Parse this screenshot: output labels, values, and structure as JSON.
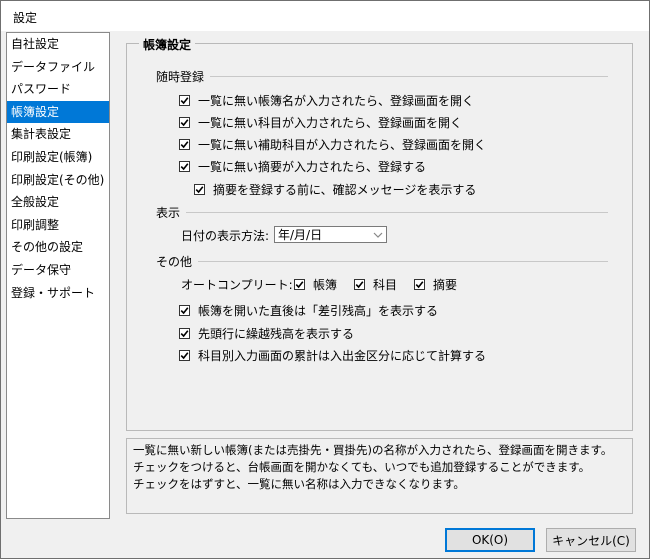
{
  "window": {
    "title": "設定"
  },
  "sidebar": {
    "items": [
      {
        "label": "自社設定"
      },
      {
        "label": "データファイル"
      },
      {
        "label": "パスワード"
      },
      {
        "label": "帳簿設定"
      },
      {
        "label": "集計表設定"
      },
      {
        "label": "印刷設定(帳簿)"
      },
      {
        "label": "印刷設定(その他)"
      },
      {
        "label": "全般設定"
      },
      {
        "label": "印刷調整"
      },
      {
        "label": "その他の設定"
      },
      {
        "label": "データ保守"
      },
      {
        "label": "登録・サポート"
      }
    ],
    "selected": "帳簿設定"
  },
  "main": {
    "group_title": "帳簿設定",
    "sections": {
      "zuiji": {
        "title": "随時登録",
        "options": [
          {
            "label": "一覧に無い帳簿名が入力されたら、登録画面を開く",
            "checked": true
          },
          {
            "label": "一覧に無い科目が入力されたら、登録画面を開く",
            "checked": true
          },
          {
            "label": "一覧に無い補助科目が入力されたら、登録画面を開く",
            "checked": true
          },
          {
            "label": "一覧に無い摘要が入力されたら、登録する",
            "checked": true
          },
          {
            "label": "摘要を登録する前に、確認メッセージを表示する",
            "checked": true
          }
        ]
      },
      "hyouji": {
        "title": "表示",
        "date_label": "日付の表示方法:",
        "date_value": "年/月/日"
      },
      "sonota": {
        "title": "その他",
        "autocomplete_label": "オートコンプリート:",
        "autocomplete": [
          {
            "label": "帳簿",
            "checked": true
          },
          {
            "label": "科目",
            "checked": true
          },
          {
            "label": "摘要",
            "checked": true
          }
        ],
        "options": [
          {
            "label": "帳簿を開いた直後は「差引残高」を表示する",
            "checked": true
          },
          {
            "label": "先頭行に繰越残高を表示する",
            "checked": true
          },
          {
            "label": "科目別入力画面の累計は入出金区分に応じて計算する",
            "checked": true
          }
        ]
      }
    }
  },
  "description": {
    "lines": [
      "一覧に無い新しい帳簿(または売掛先・買掛先)の名称が入力されたら、登録画面を開きます。",
      "チェックをつけると、台帳画面を開かなくても、いつでも追加登録することができます。",
      "チェックをはずすと、一覧に無い名称は入力できなくなります。"
    ]
  },
  "buttons": {
    "ok": "OK(O)",
    "cancel": "キャンセル(C)"
  },
  "colors": {
    "selection": "#0078d7",
    "default_button_border": "#0078d7"
  }
}
